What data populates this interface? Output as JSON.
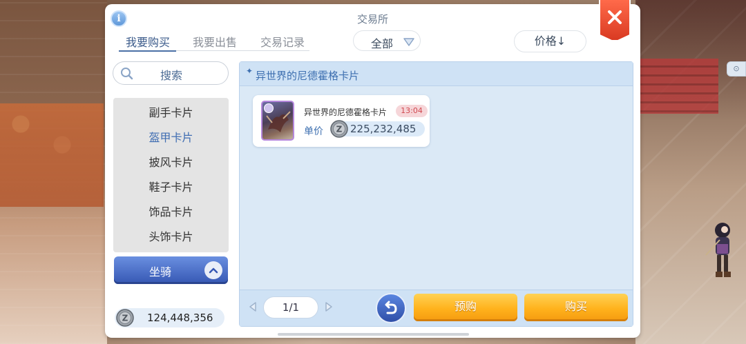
{
  "window": {
    "title": "交易所",
    "info_icon": "info-icon",
    "close_icon": "close-icon"
  },
  "tabs": [
    {
      "label": "我要购买",
      "active": true
    },
    {
      "label": "我要出售",
      "active": false
    },
    {
      "label": "交易记录",
      "active": false
    }
  ],
  "filter": {
    "category_selected": "全部",
    "sort_label": "价格↓"
  },
  "search": {
    "label": "搜索"
  },
  "categories": [
    {
      "label": "副手卡片",
      "selected": false
    },
    {
      "label": "盔甲卡片",
      "selected": true
    },
    {
      "label": "披风卡片",
      "selected": false
    },
    {
      "label": "鞋子卡片",
      "selected": false
    },
    {
      "label": "饰品卡片",
      "selected": false
    },
    {
      "label": "头饰卡片",
      "selected": false
    }
  ],
  "mount_group": {
    "label": "坐骑"
  },
  "wallet": {
    "balance": "124,448,356"
  },
  "content": {
    "header": "异世界的尼德霍格卡片",
    "items": [
      {
        "name": "异世界的尼德霍格卡片",
        "time": "13:04",
        "price_label": "单价",
        "price": "225,232,485"
      }
    ]
  },
  "pagination": {
    "page": "1/1"
  },
  "actions": {
    "preorder": "预购",
    "buy": "购买"
  },
  "colors": {
    "accent_blue": "#3d6fb0",
    "gold_button": "#ffb21c",
    "close_red": "#e5452b",
    "item_frame_purple": "#b587dc"
  }
}
